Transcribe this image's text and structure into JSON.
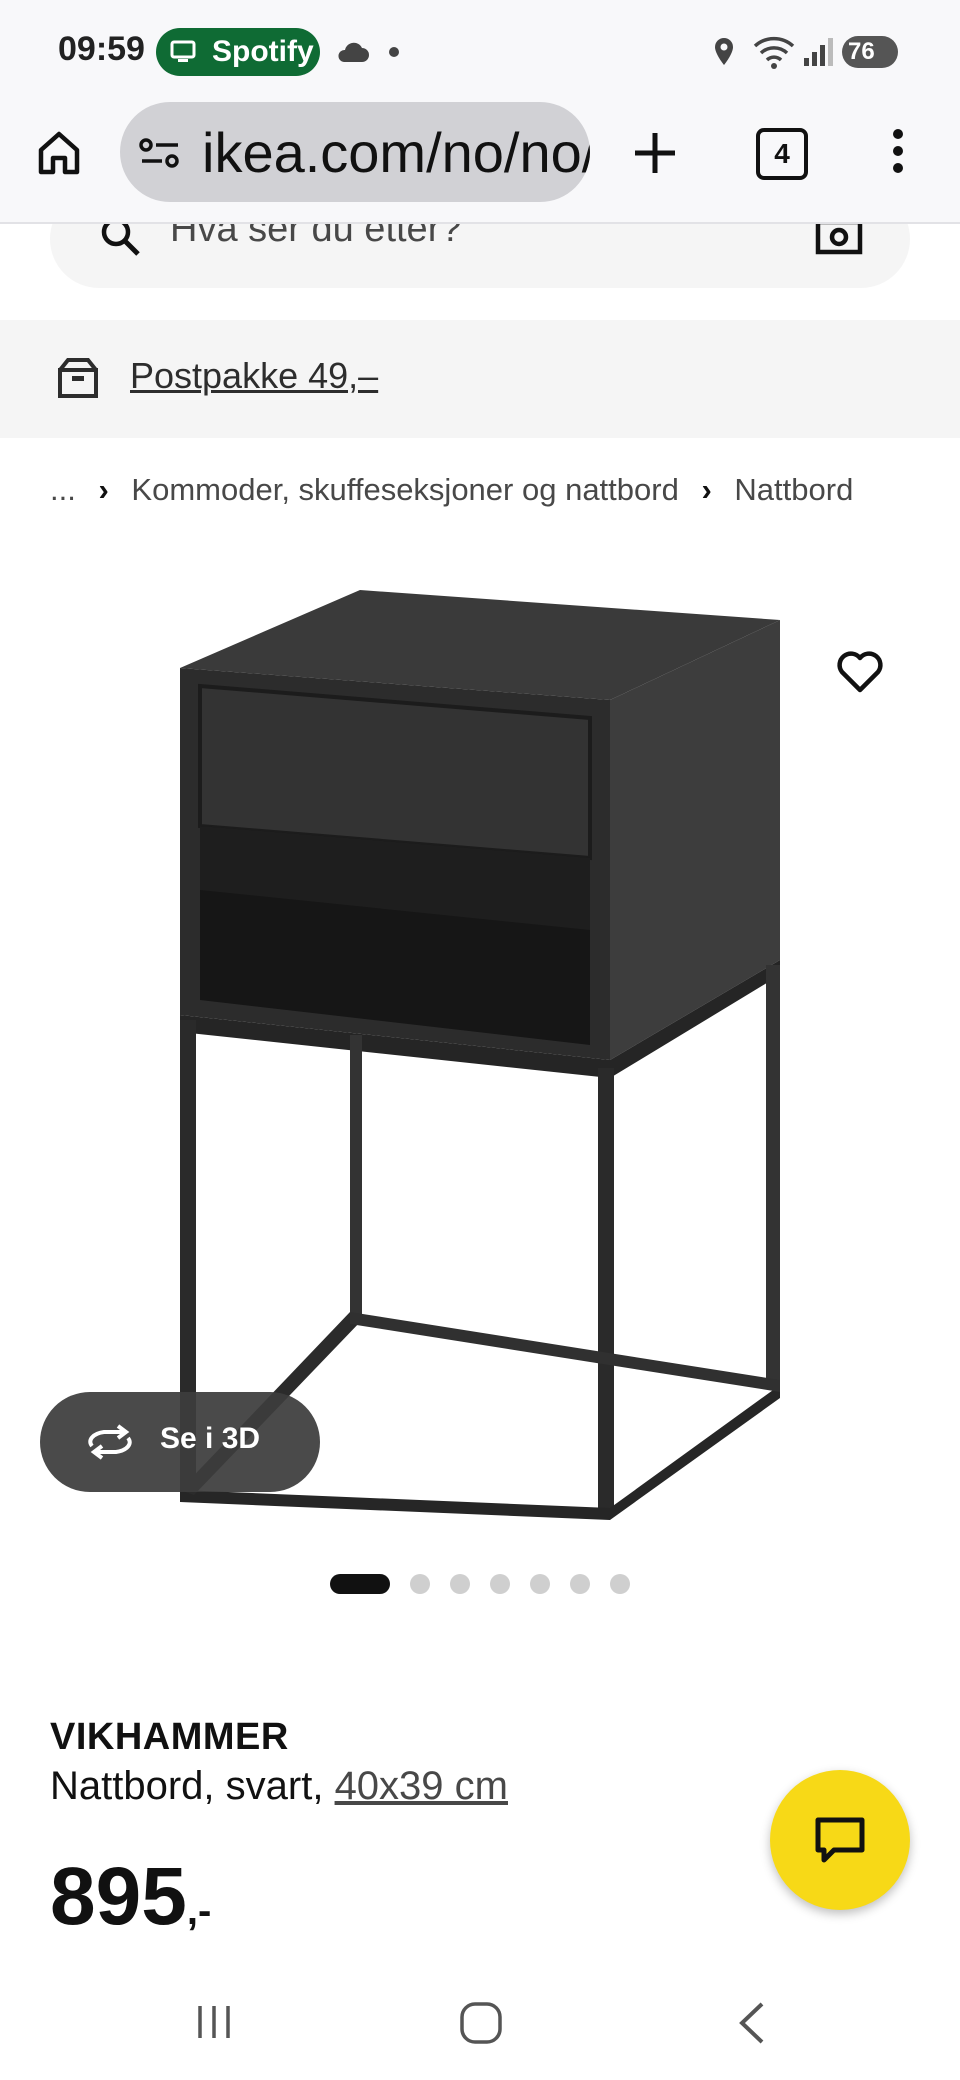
{
  "status_bar": {
    "time": "09:59",
    "spotify_label": "Spotify",
    "battery": "76"
  },
  "browser": {
    "url": "ikea.com/no/no/p/vikhammer",
    "tab_count": "4"
  },
  "search": {
    "placeholder": "Hva ser du etter?"
  },
  "delivery": {
    "label": "Postpakke 49,–"
  },
  "breadcrumb": {
    "ellipsis": "...",
    "category": "Kommoder, skuffeseksjoner og nattbord",
    "current": "Nattbord"
  },
  "gallery": {
    "view3d_label": "Se i 3D",
    "image_count": 7,
    "active_index": 0
  },
  "product": {
    "name": "VIKHAMMER",
    "description": "Nattbord, svart,",
    "size": "40x39 cm",
    "price": "895",
    "price_suffix": ",-"
  },
  "colors": {
    "accent_yellow": "#f7d917",
    "spotify_green": "#0f6b34",
    "product_black": "#2b2b2b"
  }
}
